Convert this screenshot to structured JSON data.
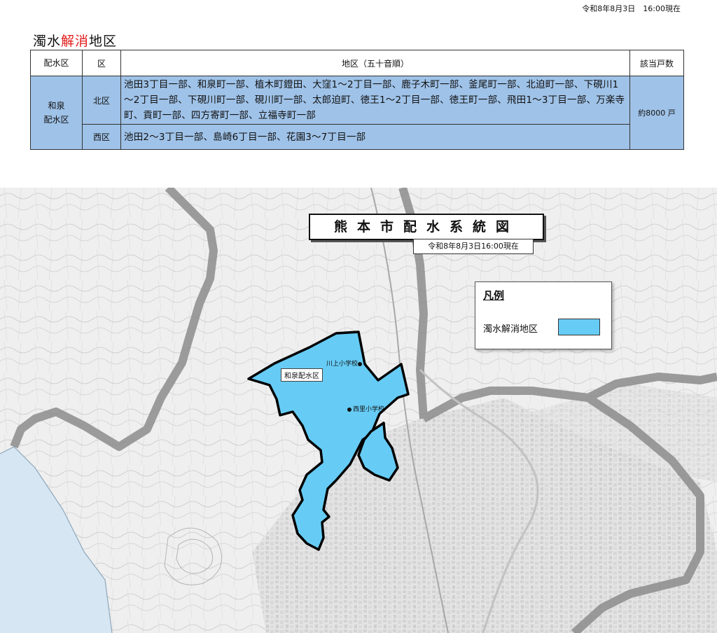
{
  "header": {
    "timestamp": "令和8年8月3日　16:00現在",
    "title_before": "濁水",
    "title_highlight": "解消",
    "title_after": "地区"
  },
  "table": {
    "headers": [
      "配水区",
      "区",
      "地区（五十音順）",
      "該当戸数"
    ],
    "haisui_area": "和泉\n配水区",
    "rows": [
      {
        "ku": "北区",
        "areas": "池田3丁目一部、和泉町一部、植木町鐙田、大窪1～2丁目一部、鹿子木町一部、釜尾町一部、北迫町一部、下硯川1～2丁目一部、下硯川町一部、硯川町一部、太郎迫町、徳王1～2丁目一部、徳王町一部、飛田1～3丁目一部、万楽寺町、貢町一部、四方寄町一部、立福寺町一部"
      },
      {
        "ku": "西区",
        "areas": "池田2～3丁目一部、島崎6丁目一部、花園3～7丁目一部"
      }
    ],
    "households": "約8000 戸"
  },
  "map": {
    "title": "熊本市配水系統図",
    "timestamp": "令和8年8月3日16:00現在",
    "legend": {
      "title": "凡例",
      "item_label": "濁水解消地区",
      "item_color": "#66ccf5"
    },
    "district_label": "和泉配水区",
    "poi": [
      "川上小学校",
      "西里小学校"
    ],
    "colors": {
      "highlight_fill": "#66ccf5",
      "boundary_gray": "#8c8c8c",
      "sea": "#d6e6f2",
      "table_fill": "#9fc2e8"
    }
  }
}
